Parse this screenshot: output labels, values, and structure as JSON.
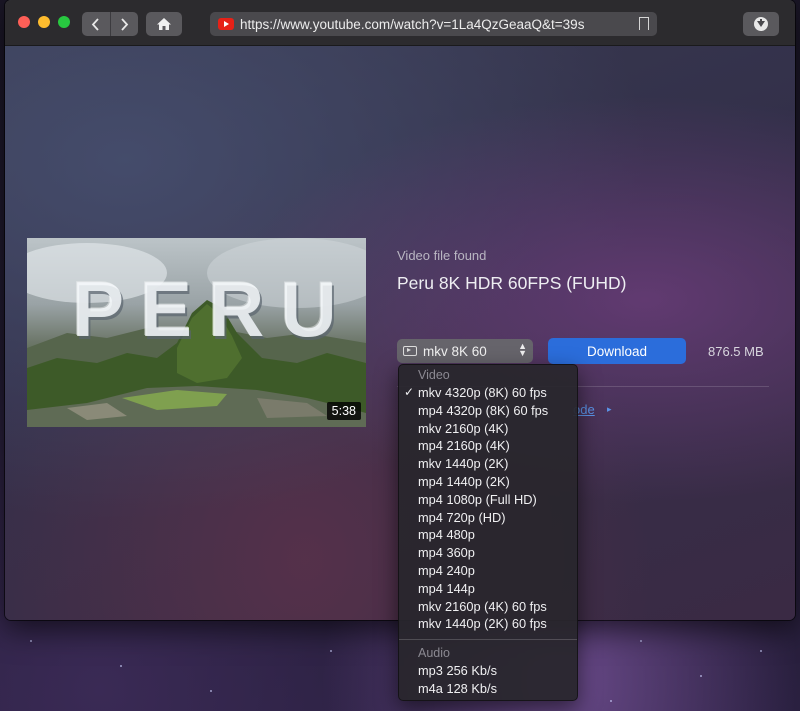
{
  "browser": {
    "url": "https://www.youtube.com/watch?v=1La4QzGeaaQ&t=39s",
    "icons": {
      "back": "chevron-left-icon",
      "forward": "chevron-right-icon",
      "home": "home-icon",
      "site": "youtube-icon",
      "bookmark": "bookmark-icon",
      "downloads": "download-icon"
    }
  },
  "video": {
    "thumbnail_text": "PERU",
    "duration": "5:38",
    "found_label": "Video file found",
    "title": "Peru 8K HDR 60FPS (FUHD)"
  },
  "controls": {
    "selected_format": "mkv 8K 60",
    "download_label": "Download",
    "file_size": "876.5 MB",
    "more_link_partial": "ode"
  },
  "dropdown": {
    "video_header": "Video",
    "video_items": [
      {
        "label": "mkv 4320p (8K) 60 fps",
        "checked": "✓"
      },
      {
        "label": "mp4 4320p (8K) 60 fps",
        "checked": ""
      },
      {
        "label": "mkv 2160p (4K)",
        "checked": ""
      },
      {
        "label": "mp4 2160p (4K)",
        "checked": ""
      },
      {
        "label": "mkv 1440p (2K)",
        "checked": ""
      },
      {
        "label": "mp4 1440p (2K)",
        "checked": ""
      },
      {
        "label": "mp4 1080p (Full HD)",
        "checked": ""
      },
      {
        "label": "mp4 720p (HD)",
        "checked": ""
      },
      {
        "label": "mp4 480p",
        "checked": ""
      },
      {
        "label": "mp4 360p",
        "checked": ""
      },
      {
        "label": "mp4 240p",
        "checked": ""
      },
      {
        "label": "mp4 144p",
        "checked": ""
      },
      {
        "label": "mkv 2160p (4K) 60 fps",
        "checked": ""
      },
      {
        "label": "mkv 1440p (2K) 60 fps",
        "checked": ""
      }
    ],
    "audio_header": "Audio",
    "audio_items": [
      {
        "label": "mp3 256 Kb/s"
      },
      {
        "label": "m4a 128 Kb/s"
      }
    ]
  },
  "colors": {
    "accent": "#2b6ddb",
    "link": "#5b94e8",
    "youtube_red": "#e62117"
  }
}
